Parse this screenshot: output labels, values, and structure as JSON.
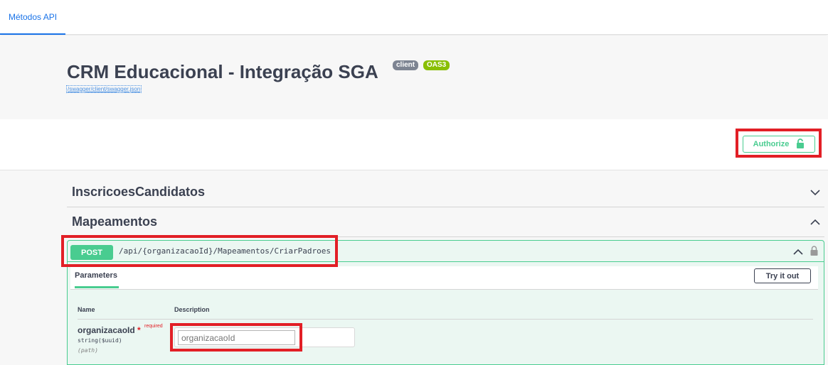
{
  "topbar": {
    "tab_label": "Métodos API"
  },
  "info": {
    "title": "CRM Educacional - Integração SGA",
    "badge_client": "client",
    "badge_oas": "OAS3",
    "spec_url": "/swagger/client/swagger.json"
  },
  "auth": {
    "button_label": "Authorize",
    "icon": "unlock-icon"
  },
  "tags": [
    {
      "name": "InscricoesCandidatos",
      "state": "collapsed"
    },
    {
      "name": "Mapeamentos",
      "state": "expanded"
    }
  ],
  "operation": {
    "method": "POST",
    "path": "/api/{organizacaoId}/Mapeamentos/CriarPadroes",
    "method_color": "#49cc90",
    "params_tab": "Parameters",
    "try_out_label": "Try it out",
    "columns": {
      "name": "Name",
      "description": "Description"
    },
    "parameter": {
      "name": "organizacaoId",
      "required_mark": "*",
      "required_label": "required",
      "type": "string($uuid)",
      "location": "(path)",
      "placeholder": "organizacaoId"
    }
  }
}
